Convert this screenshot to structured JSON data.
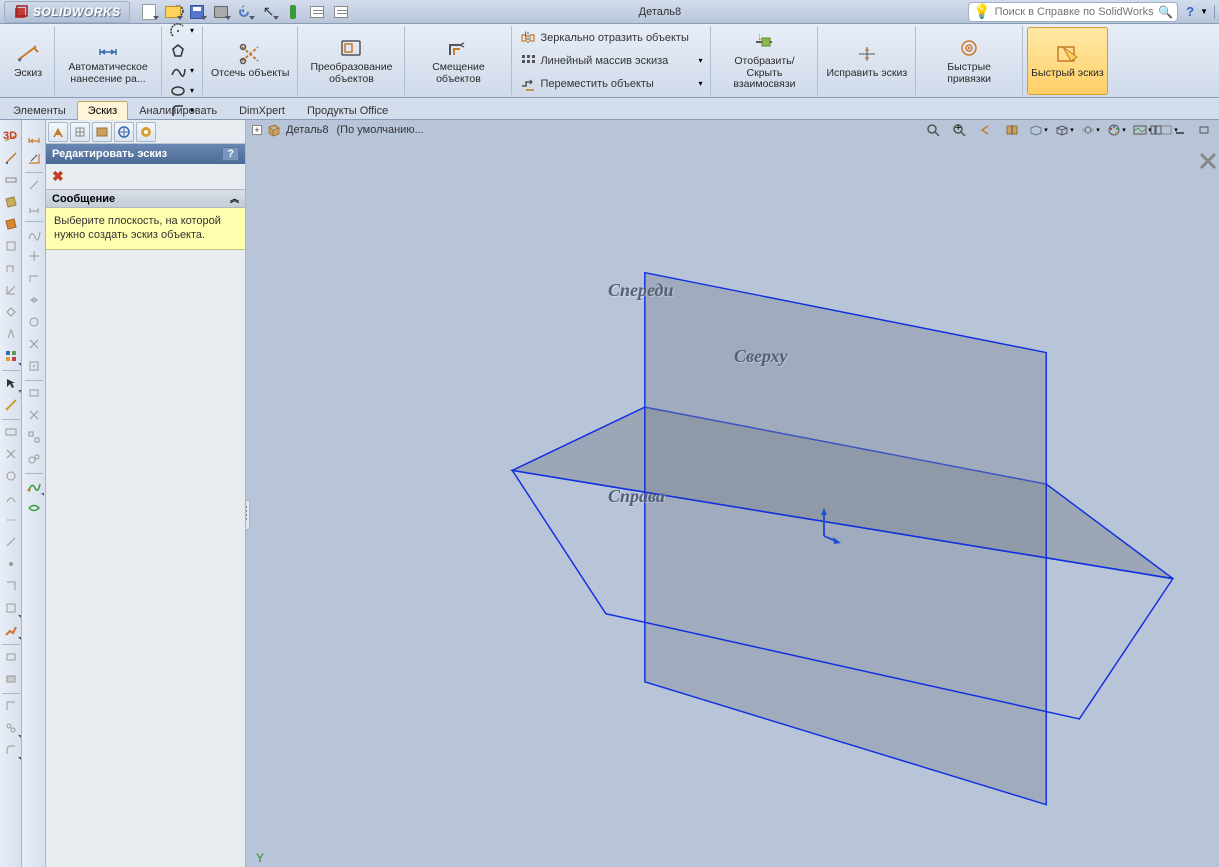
{
  "titlebar": {
    "logo": "SOLIDWORKS",
    "doc_title": "Деталь8",
    "search_placeholder": "Поиск в Справке по SolidWorks"
  },
  "ribbon": {
    "sketch_btn": "Эскиз",
    "auto_dim": "Автоматическое нанесение ра...",
    "trim": "Отсечь объекты",
    "convert": "Преобразование объектов",
    "offset": "Смещение объектов",
    "mirror": "Зеркально отразить объекты",
    "linear": "Линейный массив эскиза",
    "move": "Переместить объекты",
    "show_hide": "Отобразить/Скрыть взаимосвязи",
    "repair": "Исправить эскиз",
    "quick_snaps": "Быстрые привязки",
    "rapid_sketch": "Быстрый эскиз"
  },
  "tabs": {
    "features": "Элементы",
    "sketch": "Эскиз",
    "evaluate": "Анализировать",
    "dimxpert": "DimXpert",
    "office": "Продукты Office"
  },
  "panel": {
    "title": "Редактировать эскиз",
    "msg_header": "Сообщение",
    "msg_body": "Выберите плоскость, на которой нужно создать эскиз объекта."
  },
  "crumb": {
    "doc": "Деталь8",
    "config": "(По умолчанию..."
  },
  "planes": {
    "front": "Спереди",
    "top": "Сверху",
    "right": "Справа"
  },
  "axis_y": "Y"
}
